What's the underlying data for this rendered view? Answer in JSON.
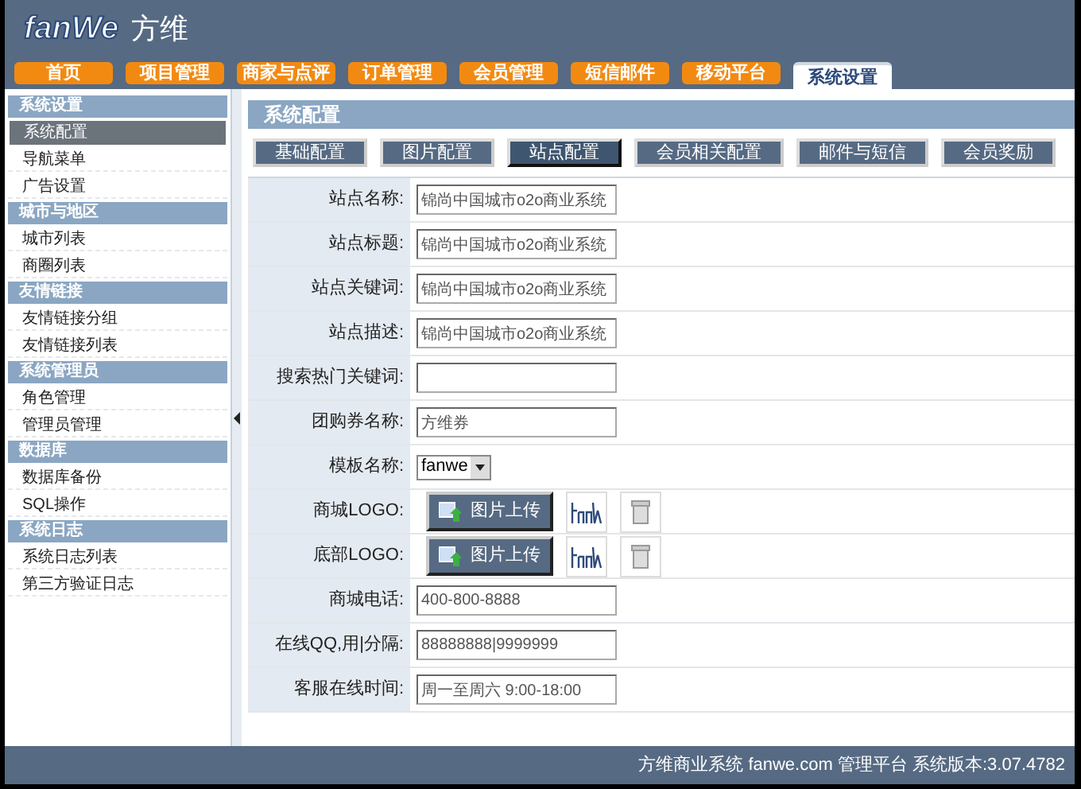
{
  "logo": {
    "brand": "fanWe",
    "name": "方维"
  },
  "nav_tabs": [
    {
      "label": "首页",
      "selected": false
    },
    {
      "label": "项目管理",
      "selected": false
    },
    {
      "label": "商家与点评",
      "selected": false
    },
    {
      "label": "订单管理",
      "selected": false
    },
    {
      "label": "会员管理",
      "selected": false
    },
    {
      "label": "短信邮件",
      "selected": false
    },
    {
      "label": "移动平台",
      "selected": false
    },
    {
      "label": "系统设置",
      "selected": true
    }
  ],
  "sidebar": {
    "groups": [
      {
        "title": "系统设置",
        "items": [
          {
            "label": "系统配置",
            "selected": true
          },
          {
            "label": "导航菜单",
            "selected": false
          },
          {
            "label": "广告设置",
            "selected": false
          }
        ]
      },
      {
        "title": "城市与地区",
        "items": [
          {
            "label": "城市列表",
            "selected": false
          },
          {
            "label": "商圈列表",
            "selected": false
          }
        ]
      },
      {
        "title": "友情链接",
        "items": [
          {
            "label": "友情链接分组",
            "selected": false
          },
          {
            "label": "友情链接列表",
            "selected": false
          }
        ]
      },
      {
        "title": "系统管理员",
        "items": [
          {
            "label": "角色管理",
            "selected": false
          },
          {
            "label": "管理员管理",
            "selected": false
          }
        ]
      },
      {
        "title": "数据库",
        "items": [
          {
            "label": "数据库备份",
            "selected": false
          },
          {
            "label": "SQL操作",
            "selected": false
          }
        ]
      },
      {
        "title": "系统日志",
        "items": [
          {
            "label": "系统日志列表",
            "selected": false
          },
          {
            "label": "第三方验证日志",
            "selected": false
          }
        ]
      }
    ]
  },
  "content": {
    "title": "系统配置",
    "sub_tabs": [
      {
        "label": "基础配置",
        "selected": false
      },
      {
        "label": "图片配置",
        "selected": false
      },
      {
        "label": "站点配置",
        "selected": true
      },
      {
        "label": "会员相关配置",
        "selected": false
      },
      {
        "label": "邮件与短信",
        "selected": false
      },
      {
        "label": "会员奖励",
        "selected": false
      }
    ],
    "form_rows": [
      {
        "kind": "text",
        "label": "站点名称:",
        "value": "锦尚中国城市o2o商业系统"
      },
      {
        "kind": "text",
        "label": "站点标题:",
        "value": "锦尚中国城市o2o商业系统"
      },
      {
        "kind": "text",
        "label": "站点关键词:",
        "value": "锦尚中国城市o2o商业系统"
      },
      {
        "kind": "text",
        "label": "站点描述:",
        "value": "锦尚中国城市o2o商业系统"
      },
      {
        "kind": "text",
        "label": "搜索热门关键词:",
        "value": ""
      },
      {
        "kind": "text",
        "label": "团购券名称:",
        "value": "方维券"
      },
      {
        "kind": "select",
        "label": "模板名称:",
        "value": "fanwe"
      },
      {
        "kind": "image",
        "label": "商城LOGO:",
        "button": "图片上传"
      },
      {
        "kind": "image",
        "label": "底部LOGO:",
        "button": "图片上传"
      },
      {
        "kind": "text",
        "label": "商城电话:",
        "value": "400-800-8888"
      },
      {
        "kind": "text",
        "label": "在线QQ,用|分隔:",
        "value": "88888888|9999999"
      },
      {
        "kind": "text",
        "label": "客服在线时间:",
        "value": "周一至周六 9:00-18:00"
      }
    ]
  },
  "footer": "方维商业系统 fanwe.com 管理平台 系统版本:3.07.4782"
}
